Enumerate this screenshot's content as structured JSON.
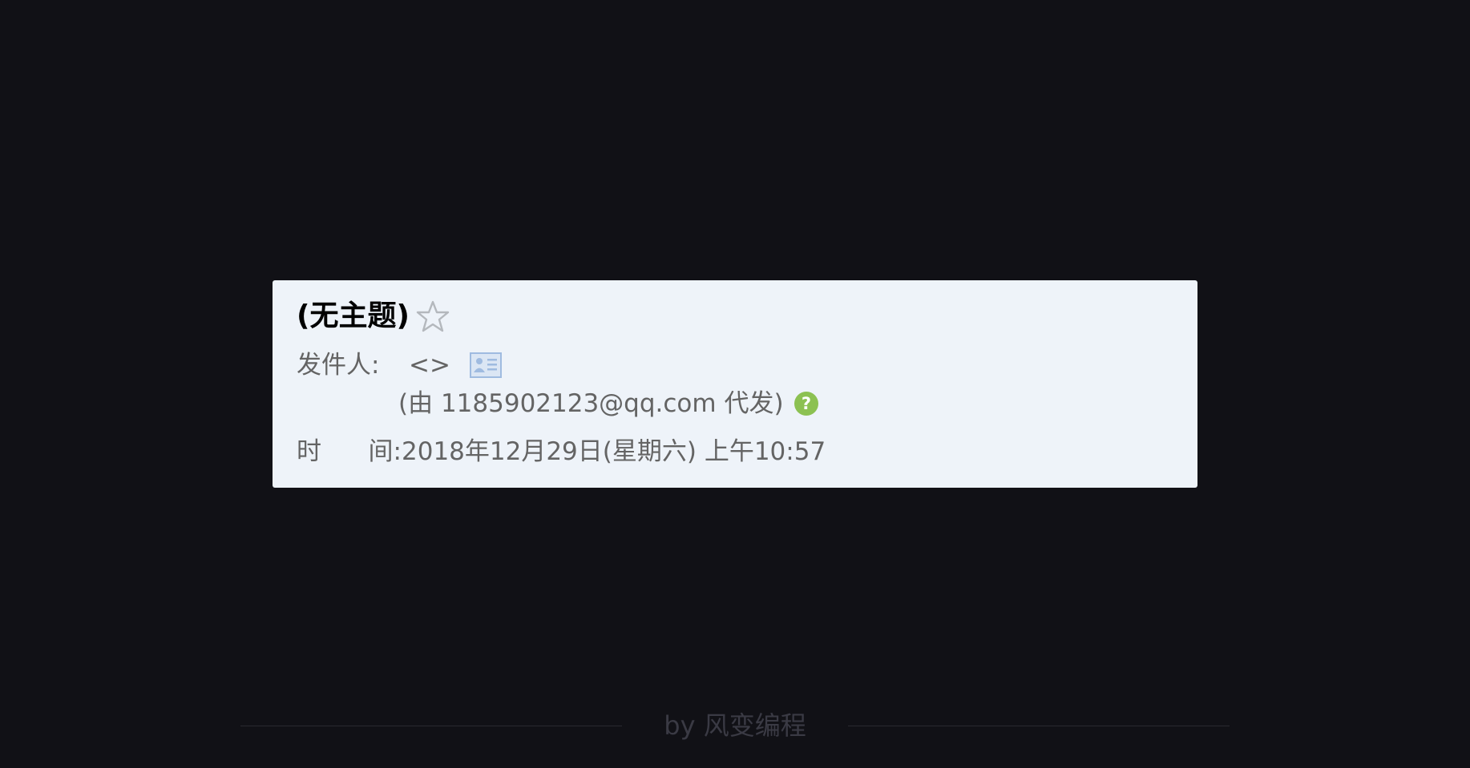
{
  "mail": {
    "subject": "(无主题)",
    "star_icon": "star-outline-icon",
    "sender_label": "发件人:",
    "sender_value": "<>",
    "contact_card_icon": "contact-card-icon",
    "proxy_text": "(由 1185902123@qq.com 代发)",
    "help_icon": "help-question-icon",
    "time_label_first": "时",
    "time_label_second": "间:",
    "time_value": "2018年12月29日(星期六) 上午10:57"
  },
  "footer": {
    "brand": "by 风变编程"
  },
  "colors": {
    "background": "#111116",
    "card": "#eef3f9",
    "label_text": "#646464",
    "help_icon": "#8cc152",
    "card_icon": "#9fbbe0"
  }
}
